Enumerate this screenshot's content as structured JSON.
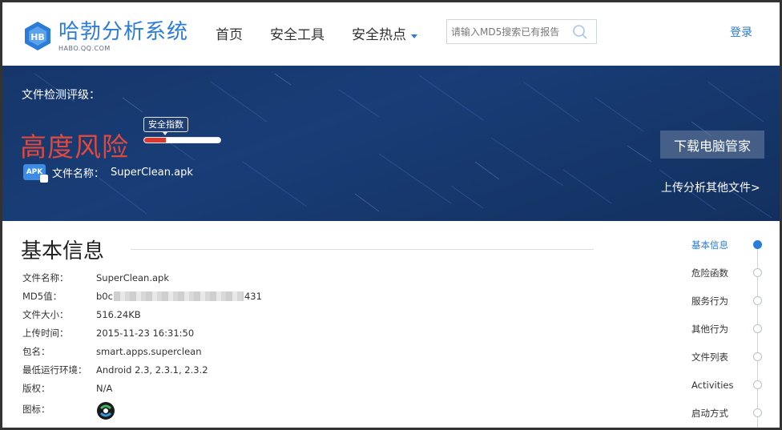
{
  "header": {
    "logo_title": "哈勃分析系统",
    "logo_sub": "HABO.QQ.COM",
    "nav": [
      "首页",
      "安全工具",
      "安全热点"
    ],
    "search_placeholder": "请输入MD5搜索已有报告",
    "login": "登录"
  },
  "banner": {
    "rating_label": "文件检测评级：",
    "risk_level": "高度风险",
    "safety_badge": "安全指数",
    "safety_fraction": 0.28,
    "file_icon_text": "APK",
    "file_label": "文件名称：",
    "file_name": "SuperClean.apk",
    "download_button": "下载电脑管家",
    "upload_link": "上传分析其他文件>"
  },
  "basic_info": {
    "title": "基本信息",
    "rows": [
      {
        "key": "文件名称：",
        "value": "SuperClean.apk"
      },
      {
        "key": "MD5值：",
        "value_prefix": "b0c",
        "value_suffix": "431"
      },
      {
        "key": "文件大小：",
        "value": "516.24KB"
      },
      {
        "key": "上传时间：",
        "value": "2015-11-23 16:31:50"
      },
      {
        "key": "包名：",
        "value": "smart.apps.superclean"
      },
      {
        "key": "最低运行环境：",
        "value": "Android 2.3, 2.3.1, 2.3.2"
      },
      {
        "key": "版权：",
        "value": "N/A"
      },
      {
        "key": "图标："
      }
    ]
  },
  "side_nav": {
    "items": [
      "基本信息",
      "危险函数",
      "服务行为",
      "其他行为",
      "文件列表",
      "Activities",
      "启动方式"
    ],
    "active_index": 0
  },
  "colors": {
    "brand_blue": "#2b7bd9",
    "risk_red": "#e0483e",
    "banner_bg": "#183d77"
  }
}
